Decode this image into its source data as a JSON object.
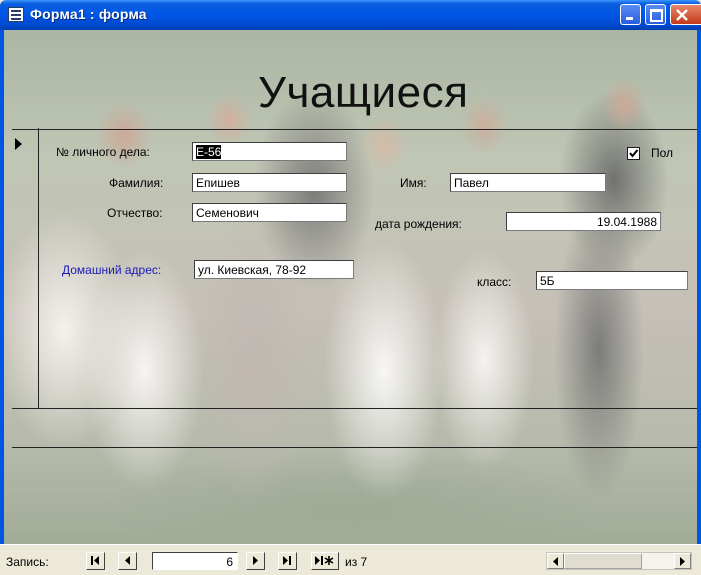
{
  "window": {
    "title": "Форма1 : форма"
  },
  "form": {
    "heading": "Учащиеся",
    "fields": {
      "case_number": {
        "label": "№ личного дела:",
        "value": "Е-56"
      },
      "surname": {
        "label": "Фамилия:",
        "value": "Епишев"
      },
      "first_name": {
        "label": "Имя:",
        "value": "Павел"
      },
      "patronymic": {
        "label": "Отчество:",
        "value": "Семенович"
      },
      "birth_date": {
        "label": "дата рождения:",
        "value": "19.04.1988"
      },
      "home_address": {
        "label": "Домашний адрес:",
        "value": "ул. Киевская, 78-92",
        "label_color": "#1a1ab8"
      },
      "class": {
        "label": "класс:",
        "value": "5Б"
      },
      "gender": {
        "label": "Пол",
        "checked": true
      }
    }
  },
  "navigation": {
    "record_label": "Запись:",
    "current_record": "6",
    "of_label": "из 7"
  },
  "icons": [
    "form-icon",
    "minimize-icon",
    "maximize-icon",
    "close-icon",
    "first-record-icon",
    "prev-record-icon",
    "next-record-icon",
    "last-record-icon",
    "new-record-icon",
    "scroll-left-icon",
    "scroll-right-icon",
    "checkmark-icon",
    "record-selector-icon"
  ],
  "colors": {
    "titlebar": "#0055e5",
    "address_label": "#1a1ab8"
  }
}
